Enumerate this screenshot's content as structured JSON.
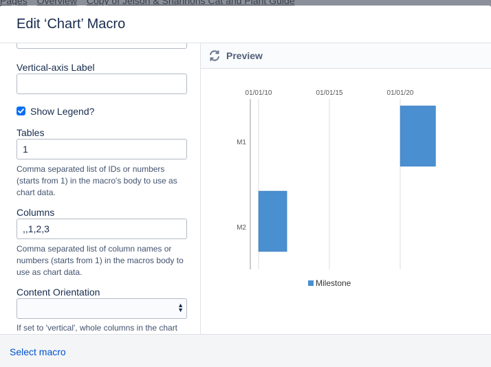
{
  "backdrop": {
    "breadcrumbs": [
      "Pages",
      "Overview",
      "Copy of Jelson & Shannons Cat and Plant Guide"
    ]
  },
  "dialog": {
    "title": "Edit ‘Chart’ Macro"
  },
  "form": {
    "vertical_axis_label": {
      "label": "Vertical-axis Label",
      "value": ""
    },
    "show_legend": {
      "label": "Show Legend?",
      "checked": true
    },
    "tables": {
      "label": "Tables",
      "value": "1",
      "help": "Comma separated list of IDs or numbers (starts from 1) in the macro's body to use as chart data."
    },
    "columns": {
      "label": "Columns",
      "value": ",,1,2,3",
      "help": "Comma separated list of column names or numbers (starts from 1) in the macros body to use as chart data."
    },
    "content_orientation": {
      "label": "Content Orientation",
      "value": "",
      "help": "If set to 'vertical', whole columns in the chart data table will be used as a series. Otherwise"
    }
  },
  "preview": {
    "title": "Preview",
    "refresh_icon": "refresh-icon"
  },
  "chart_data": {
    "type": "bar",
    "orientation": "gantt",
    "x_ticks": [
      "01/01/10",
      "01/01/15",
      "01/01/20"
    ],
    "categories": [
      "M1",
      "M2"
    ],
    "series": [
      {
        "name": "Milestone",
        "color": "#4a8fcf",
        "values": [
          {
            "category": "M1",
            "start": "2020-01-01",
            "end": "2022-07-01"
          },
          {
            "category": "M2",
            "start": "2010-01-01",
            "end": "2012-01-01"
          }
        ]
      }
    ],
    "grid": true,
    "legend": "bottom"
  },
  "footer": {
    "select_macro_link": "Select macro"
  }
}
